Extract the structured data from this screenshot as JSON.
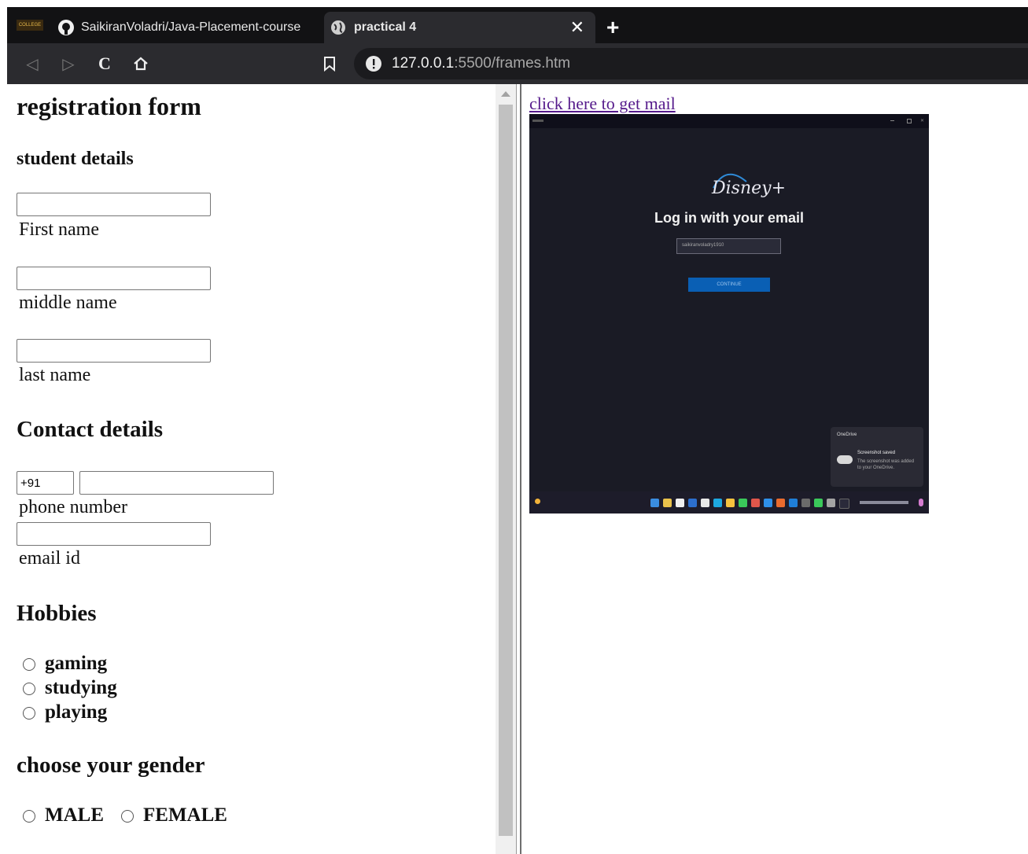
{
  "browser": {
    "tabs": [
      {
        "label": "SaikiranVoladri/Java-Placement-course",
        "active": false
      },
      {
        "label": "practical 4",
        "active": true
      }
    ],
    "college_tab_label": "COLLEGE",
    "url_host": "127.0.0.1",
    "url_path": ":5500/frames.htm"
  },
  "form": {
    "title": "registration form",
    "student_heading": "student details",
    "first_name_label": "First name",
    "middle_name_label": "middle name",
    "last_name_label": "last name",
    "contact_heading": "Contact details",
    "country_code": "+91",
    "phone_label": "phone number",
    "email_label": "email id",
    "hobbies_heading": "Hobbies",
    "hobbies": [
      "gaming",
      "studying",
      "playing"
    ],
    "gender_heading": "choose your gender",
    "genders": [
      "MALE",
      "FEMALE"
    ]
  },
  "right": {
    "link_text": "click here to get mail",
    "screenshot": {
      "brand": "Disney+",
      "heading": "Log in with your email",
      "email_value": "saikiranvoladry1910",
      "continue_label": "CONTINUE",
      "toast_app": "OneDrive",
      "toast_title": "Screenshot saved",
      "toast_body": "The screenshot was added to your OneDrive."
    }
  }
}
